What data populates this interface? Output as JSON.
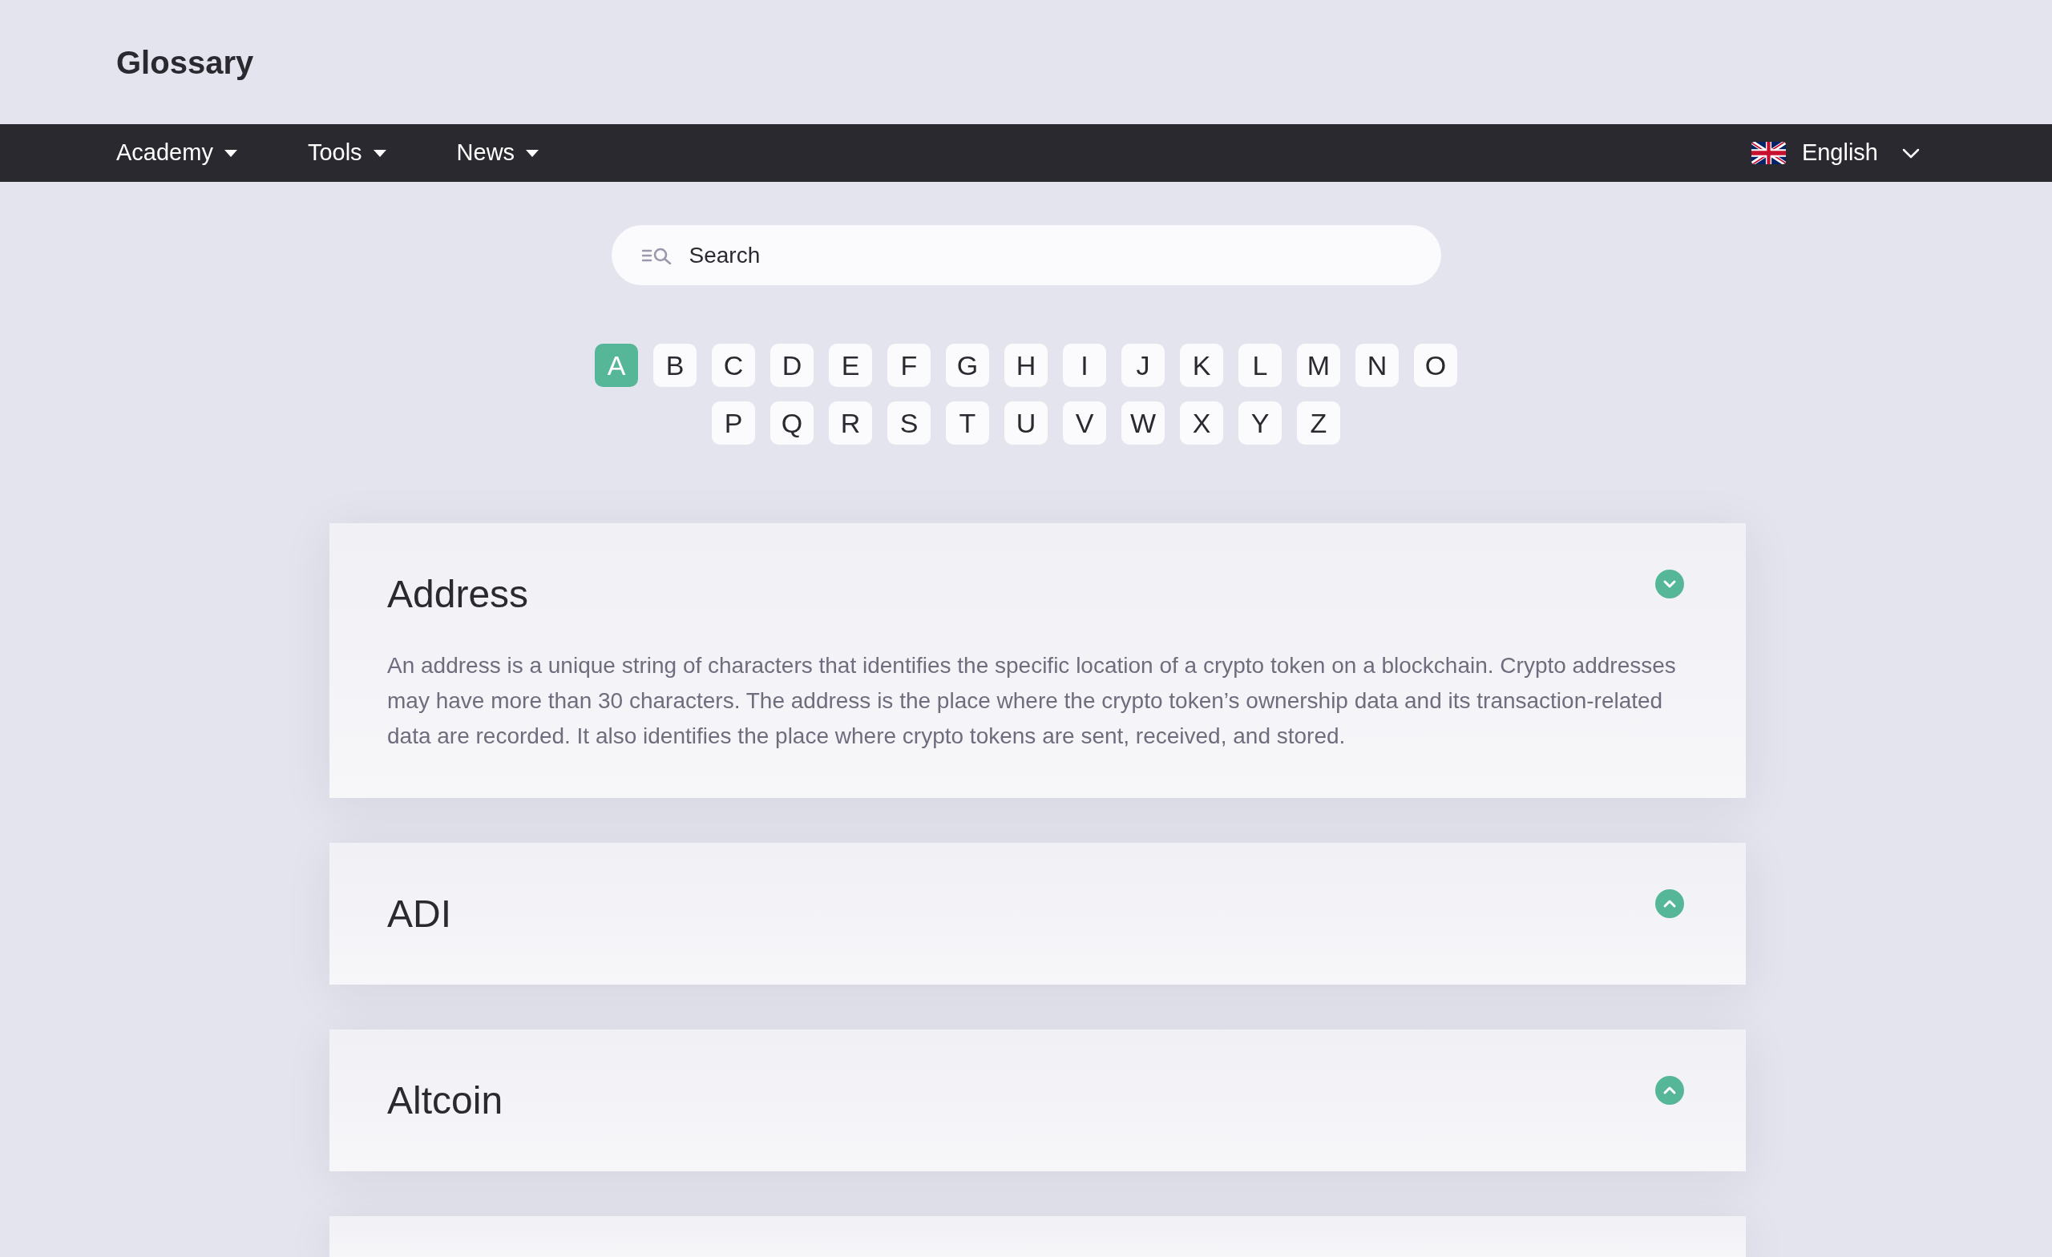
{
  "header": {
    "title": "Glossary"
  },
  "nav": {
    "items": [
      {
        "label": "Academy"
      },
      {
        "label": "Tools"
      },
      {
        "label": "News"
      }
    ],
    "language": {
      "label": "English"
    }
  },
  "search": {
    "placeholder": "Search"
  },
  "letters": [
    {
      "label": "A",
      "selected": true
    },
    {
      "label": "B",
      "selected": false
    },
    {
      "label": "C",
      "selected": false
    },
    {
      "label": "D",
      "selected": false
    },
    {
      "label": "E",
      "selected": false
    },
    {
      "label": "F",
      "selected": false
    },
    {
      "label": "G",
      "selected": false
    },
    {
      "label": "H",
      "selected": false
    },
    {
      "label": "I",
      "selected": false
    },
    {
      "label": "J",
      "selected": false
    },
    {
      "label": "K",
      "selected": false
    },
    {
      "label": "L",
      "selected": false
    },
    {
      "label": "M",
      "selected": false
    },
    {
      "label": "N",
      "selected": false
    },
    {
      "label": "O",
      "selected": false
    },
    {
      "label": "P",
      "selected": false
    },
    {
      "label": "Q",
      "selected": false
    },
    {
      "label": "R",
      "selected": false
    },
    {
      "label": "S",
      "selected": false
    },
    {
      "label": "T",
      "selected": false
    },
    {
      "label": "U",
      "selected": false
    },
    {
      "label": "V",
      "selected": false
    },
    {
      "label": "W",
      "selected": false
    },
    {
      "label": "X",
      "selected": false
    },
    {
      "label": "Y",
      "selected": false
    },
    {
      "label": "Z",
      "selected": false
    }
  ],
  "entries": [
    {
      "term": "Address",
      "expanded": true,
      "definition": "An address is a unique string of characters that identifies the specific location of a crypto token on a blockchain. Crypto addresses may have more than 30 characters. The address is the place where the crypto token’s ownership data and its transaction-related data are recorded. It also identifies the place where crypto tokens are sent, received, and stored."
    },
    {
      "term": "ADI",
      "expanded": false
    },
    {
      "term": "Altcoin",
      "expanded": false
    }
  ]
}
